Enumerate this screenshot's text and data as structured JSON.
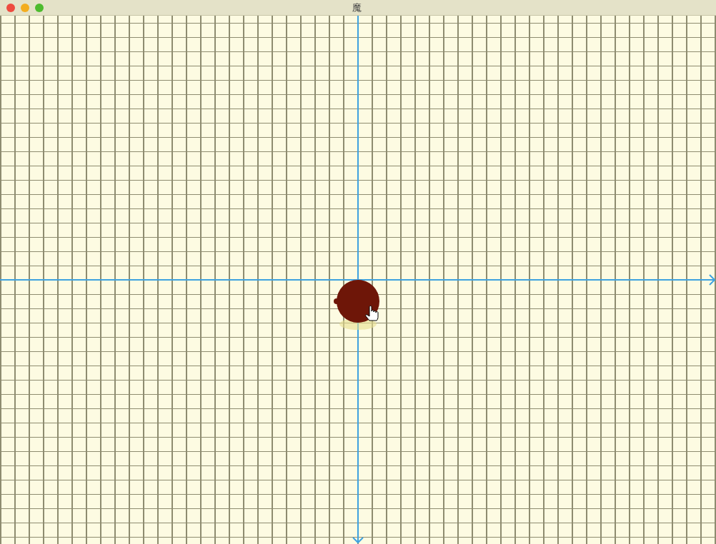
{
  "window": {
    "title": "魔"
  }
}
